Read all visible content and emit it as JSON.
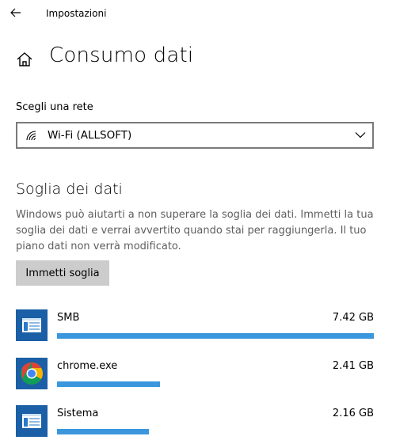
{
  "window": {
    "title": "Impostazioni",
    "back_icon": "arrow-left-icon"
  },
  "page": {
    "home_icon": "home-icon",
    "title": "Consumo dati"
  },
  "network": {
    "label": "Scegli una rete",
    "selected": "Wi-Fi (ALLSOFT)",
    "icon": "wifi-icon"
  },
  "threshold": {
    "title": "Soglia dei dati",
    "description": "Windows può aiutarti a non superare la soglia dei dati. Immetti la tua soglia dei dati e verrai avvertito quando stai per raggiungerla. Il tuo piano dati non verrà modificato.",
    "button_label": "Immetti soglia"
  },
  "apps": [
    {
      "name": "SMB",
      "usage": "7.42 GB",
      "usage_gb": 7.42,
      "icon": "window-app-icon"
    },
    {
      "name": "chrome.exe",
      "usage": "2.41 GB",
      "usage_gb": 2.41,
      "icon": "chrome-icon"
    },
    {
      "name": "Sistema",
      "usage": "2.16 GB",
      "usage_gb": 2.16,
      "icon": "window-app-icon"
    }
  ],
  "colors": {
    "accent_bar": "#3a96dd",
    "app_tile": "#1b5fa6",
    "button_bg": "#cccccc"
  }
}
